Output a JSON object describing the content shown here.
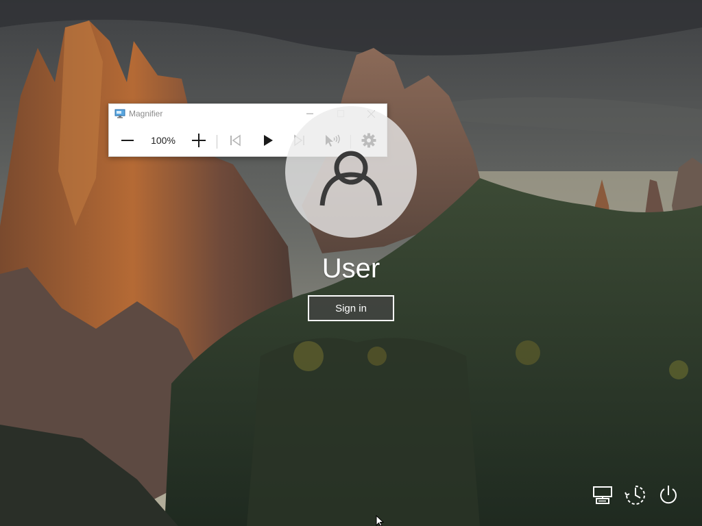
{
  "window": {
    "title": "Magnifier",
    "app_icon": "magnifier-app-icon",
    "caption_buttons": [
      "minimize-icon",
      "maximize-icon",
      "close-icon"
    ]
  },
  "toolbar": {
    "zoom_out_icon": "minus-icon",
    "zoom_level": "100%",
    "zoom_in_icon": "plus-icon",
    "previous_icon": "skip-previous-icon",
    "play_icon": "play-icon",
    "next_icon": "skip-next-icon",
    "read_from_here_icon": "read-from-here-icon",
    "settings_icon": "gear-icon"
  },
  "lock_screen": {
    "user_name": "User",
    "sign_in_label": "Sign in",
    "avatar_icon": "user-silhouette-icon"
  },
  "system_icons": [
    "network-icon",
    "ease-of-access-icon",
    "power-icon"
  ],
  "colors": {
    "toolbar_icon": "#1a1a1a",
    "disabled_icon": "#b4b4b4",
    "text_white": "#ffffff"
  }
}
